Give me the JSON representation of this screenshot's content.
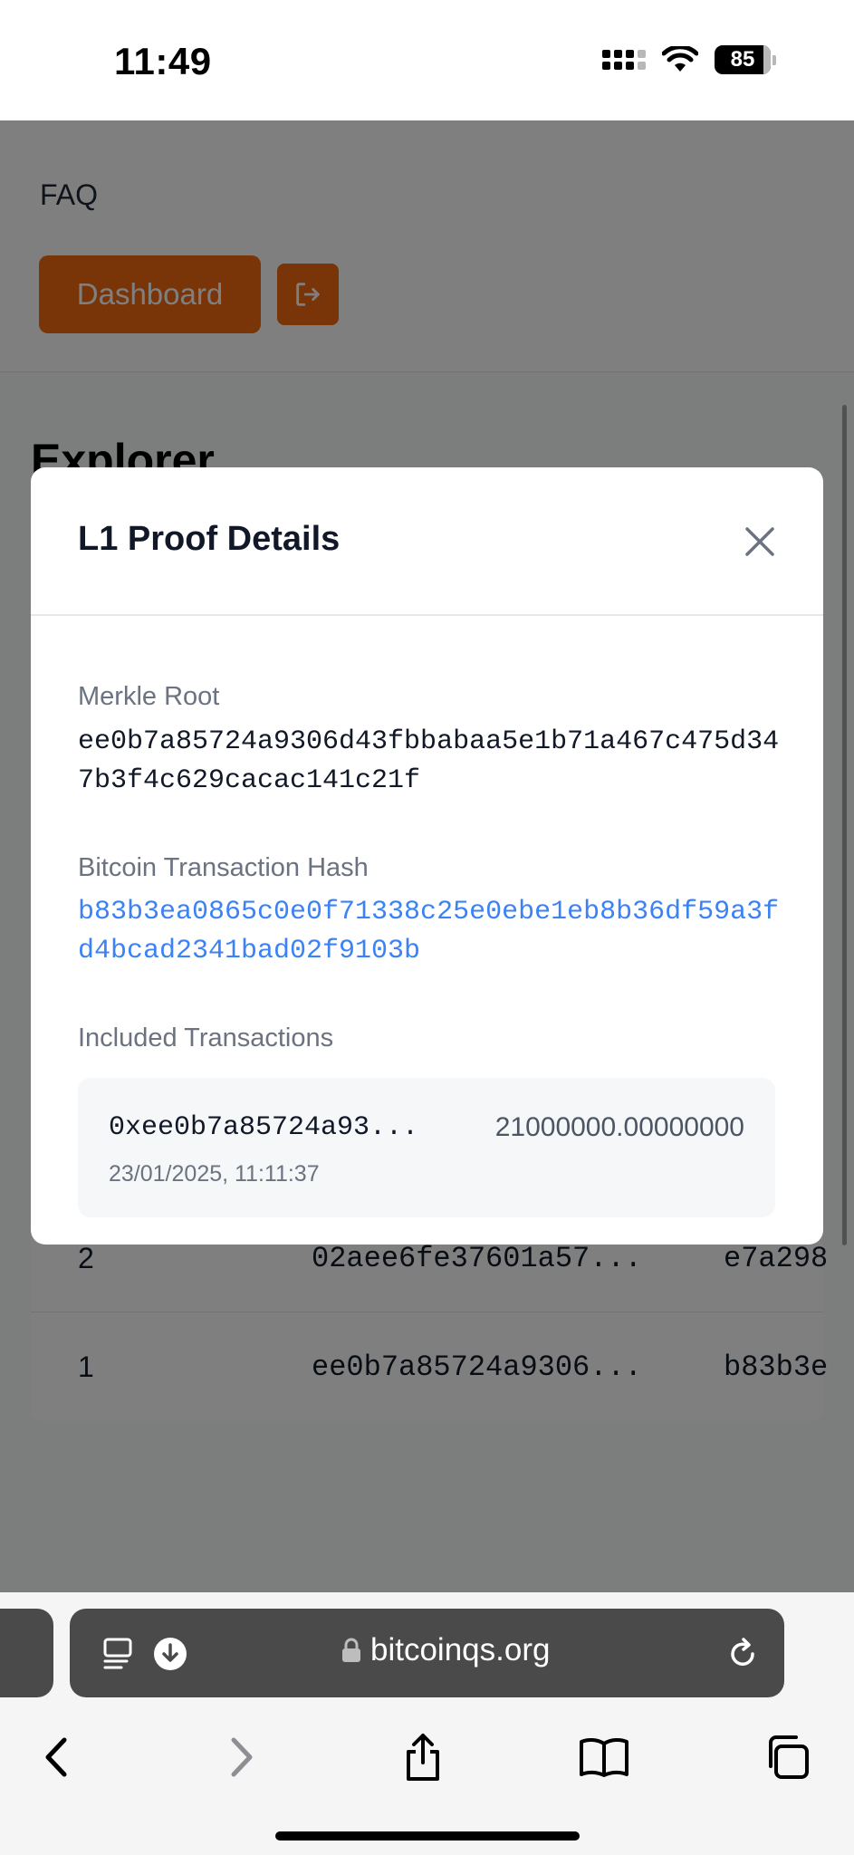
{
  "status_bar": {
    "time": "11:49",
    "battery": "85"
  },
  "nav": {
    "faq": "FAQ",
    "dashboard": "Dashboard"
  },
  "page": {
    "title": "Explorer",
    "rows": [
      {
        "num": "2",
        "hash": "02aee6fe37601a57...",
        "tx": "e7a298"
      },
      {
        "num": "1",
        "hash": "ee0b7a85724a9306...",
        "tx": "b83b3e"
      }
    ]
  },
  "modal": {
    "title": "L1 Proof Details",
    "merkle_label": "Merkle Root",
    "merkle_value": "ee0b7a85724a9306d43fbbabaa5e1b71a467c475d347b3f4c629cacac141c21f",
    "btc_label": "Bitcoin Transaction Hash",
    "btc_value": "b83b3ea0865c0e0f71338c25e0ebe1eb8b36df59a3fd4bcad2341bad02f9103b",
    "included_label": "Included Transactions",
    "transactions": [
      {
        "hash": "0xee0b7a85724a93...",
        "amount": "21000000.00000000",
        "time": "23/01/2025, 11:11:37"
      }
    ]
  },
  "browser": {
    "url": "bitcoinqs.org"
  },
  "colors": {
    "accent": "#f26b0f",
    "link": "#3b82f6"
  }
}
